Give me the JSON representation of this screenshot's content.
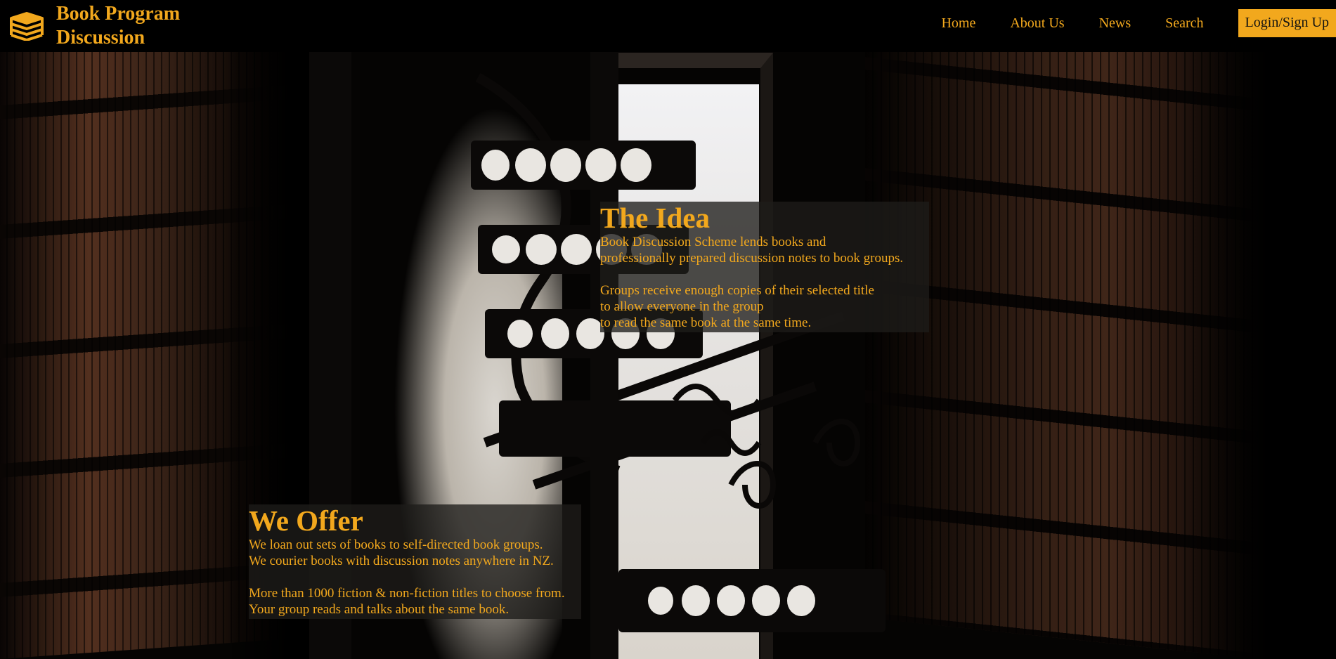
{
  "brand": {
    "name_line1": "Book Program",
    "name_line2": "Discussion",
    "logo_icon": "book-stack-icon"
  },
  "nav": {
    "items": [
      {
        "label": "Home"
      },
      {
        "label": "About Us"
      },
      {
        "label": "News"
      },
      {
        "label": "Search"
      }
    ],
    "login_label": "Login/Sign Up"
  },
  "idea": {
    "title": "The Idea",
    "lines": [
      "Book Discussion Scheme lends books and",
      "professionally prepared discussion notes to book groups.",
      "",
      "Groups receive enough copies of their selected title",
      "to allow everyone in the group",
      "to read the same book at the same time."
    ]
  },
  "offer": {
    "title": "We Offer",
    "lines": [
      "We loan out sets of books to self-directed book groups.",
      "We courier books with discussion notes anywhere in NZ.",
      "",
      "More than 1000 fiction & non-fiction titles to choose from.",
      "Your group reads and talks about the same book."
    ]
  },
  "colors": {
    "accent": "#f2a81d",
    "header_bg": "#000000",
    "panel_bg": "#1e1c1a"
  }
}
